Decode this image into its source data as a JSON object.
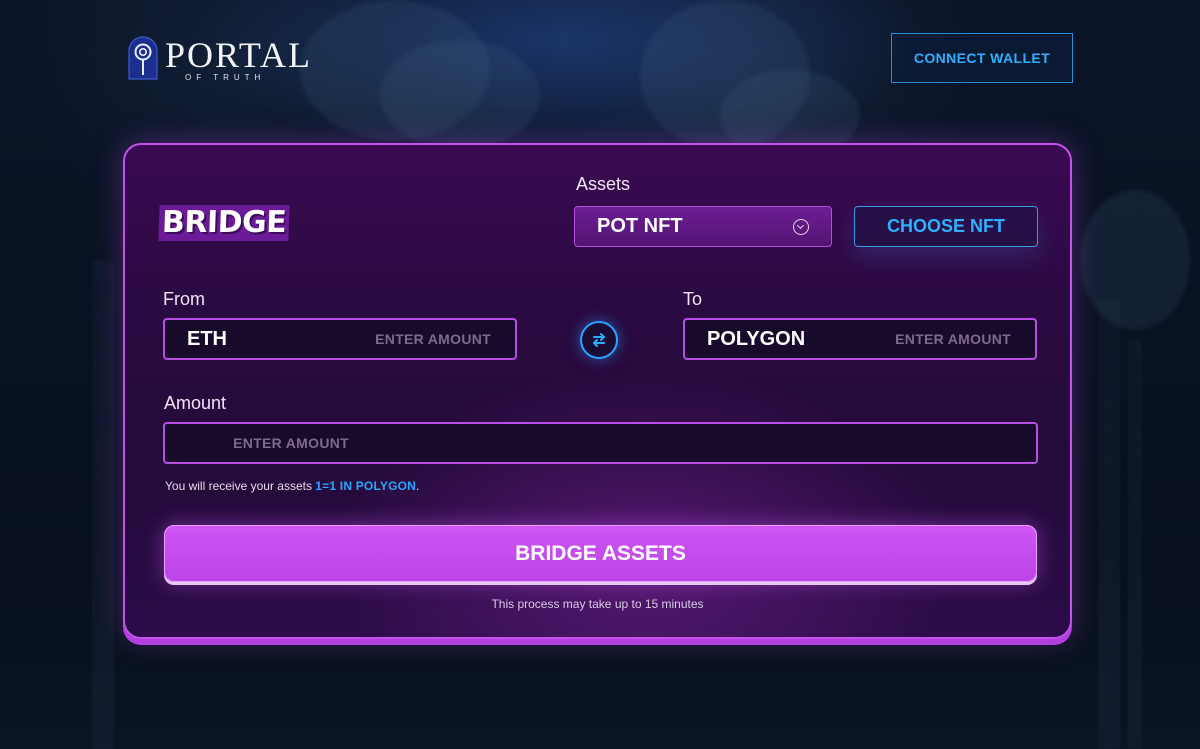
{
  "brand": {
    "name": "PORTAL",
    "tagline": "OF TRUTH"
  },
  "header": {
    "connect_wallet": "CONNECT WALLET"
  },
  "bridge": {
    "title": "BRIDGE",
    "assets_label": "Assets",
    "asset_selected": "POT NFT",
    "choose_nft": "CHOOSE NFT",
    "from_label": "From",
    "from_token": "ETH",
    "from_placeholder": "ENTER AMOUNT",
    "to_label": "To",
    "to_token": "POLYGON",
    "to_placeholder": "ENTER AMOUNT",
    "amount_label": "Amount",
    "amount_placeholder": "ENTER AMOUNT",
    "note_prefix": "You will receive your assets ",
    "note_highlight": "1=1 IN POLYGON",
    "note_suffix": ".",
    "submit": "BRIDGE ASSETS",
    "footnote": "This process may take up to 15 minutes"
  },
  "icons": {
    "dropdown": "chevron-down-circle-icon",
    "swap": "swap-arrows-icon",
    "logo": "portal-keyhole-icon"
  },
  "colors": {
    "accent_purple": "#c552ea",
    "accent_blue": "#2fb0ff",
    "button_purple": "#c94cf0"
  }
}
